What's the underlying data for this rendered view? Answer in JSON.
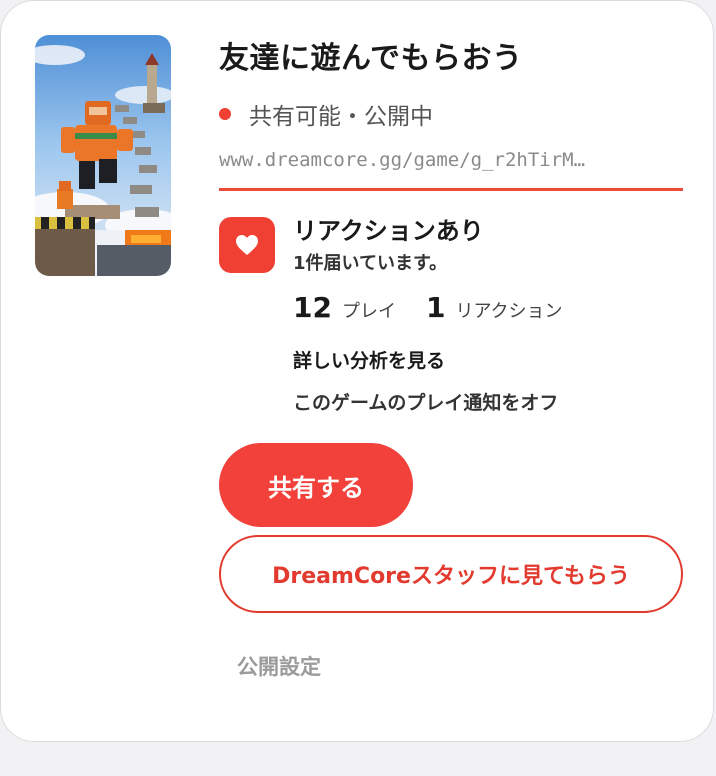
{
  "card": {
    "title": "友達に遊んでもらおう",
    "status_text": "共有可能・公開中",
    "share_url": "www.dreamcore.gg/game/g_r2hTirM…",
    "reaction": {
      "title": "リアクションあり",
      "subtitle": "1件届いています。",
      "icon": "heart-icon"
    },
    "stats": {
      "plays_value": "12",
      "plays_label": "プレイ",
      "reactions_value": "1",
      "reactions_label": "リアクション"
    },
    "links": {
      "analysis": "詳しい分析を見る",
      "notify_off": "このゲームのプレイ通知をオフ"
    },
    "buttons": {
      "share": "共有する",
      "staff_review": "DreamCoreスタッフに見てもらう",
      "publish_settings": "公開設定"
    }
  },
  "colors": {
    "accent": "#f2403a",
    "status_dot": "#f04034",
    "muted_text": "#9a9a9a"
  }
}
